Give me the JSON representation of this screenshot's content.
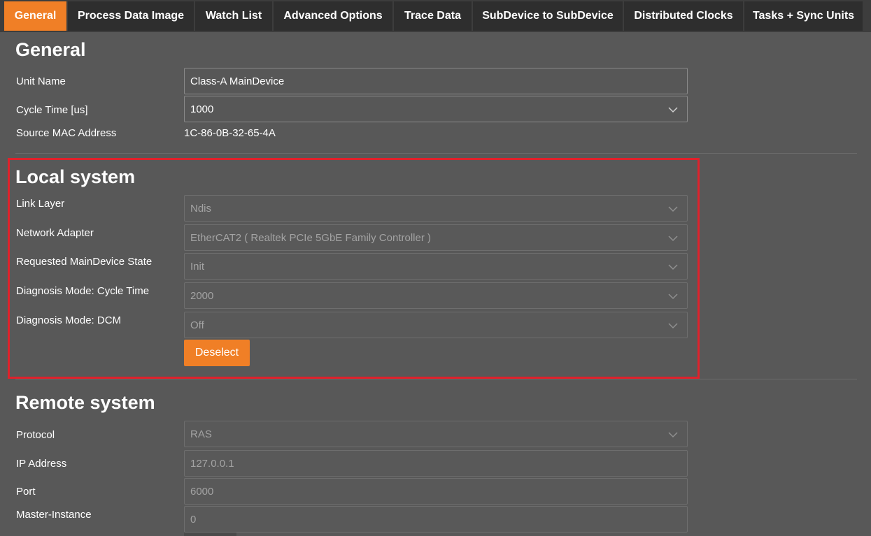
{
  "tabs": [
    {
      "label": "General"
    },
    {
      "label": "Process Data Image"
    },
    {
      "label": "Watch List"
    },
    {
      "label": "Advanced Options"
    },
    {
      "label": "Trace Data"
    },
    {
      "label": "SubDevice to SubDevice"
    },
    {
      "label": "Distributed Clocks"
    },
    {
      "label": "Tasks + Sync Units"
    }
  ],
  "active_tab": "General",
  "general": {
    "title": "General",
    "unit_name_label": "Unit Name",
    "unit_name_value": "Class-A MainDevice",
    "cycle_time_label": "Cycle Time [us]",
    "cycle_time_value": "1000",
    "mac_label": "Source MAC Address",
    "mac_value": "1C-86-0B-32-65-4A"
  },
  "local": {
    "title": "Local system",
    "link_layer_label": "Link Layer",
    "link_layer_value": "Ndis",
    "adapter_label": "Network Adapter",
    "adapter_value": "EtherCAT2 ( Realtek PCIe 5GbE Family Controller )",
    "state_label": "Requested MainDevice State",
    "state_value": "Init",
    "diag_cycle_label": "Diagnosis Mode: Cycle Time",
    "diag_cycle_value": "2000",
    "diag_dcm_label": "Diagnosis Mode: DCM",
    "diag_dcm_value": "Off",
    "deselect_label": "Deselect"
  },
  "remote": {
    "title": "Remote system",
    "protocol_label": "Protocol",
    "protocol_value": "RAS",
    "ip_label": "IP Address",
    "ip_value": "127.0.0.1",
    "port_label": "Port",
    "port_value": "6000",
    "instance_label": "Master-Instance",
    "instance_value": "0"
  },
  "colors": {
    "accent": "#f07f26",
    "highlight_border": "#e0212b",
    "background": "#585858"
  }
}
